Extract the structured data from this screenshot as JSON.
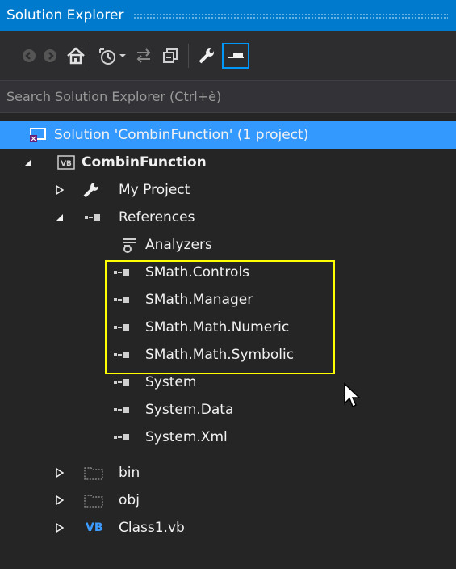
{
  "panel": {
    "title": "Solution Explorer"
  },
  "toolbar": {
    "buttons": [
      "back-icon",
      "forward-icon",
      "home-icon",
      "pending-changes-icon",
      "dropdown-icon",
      "sync-icon",
      "collapse-all-icon",
      "properties-icon",
      "preview-icon"
    ]
  },
  "search": {
    "placeholder": "Search Solution Explorer (Ctrl+è)"
  },
  "tree": {
    "solution": "Solution 'CombinFunction' (1 project)",
    "project": "CombinFunction",
    "my_project": "My Project",
    "references": "References",
    "analyzers": "Analyzers",
    "ref_items": [
      "SMath.Controls",
      "SMath.Manager",
      "SMath.Math.Numeric",
      "SMath.Math.Symbolic",
      "System",
      "System.Data",
      "System.Xml"
    ],
    "bin": "bin",
    "obj": "obj",
    "class_file": "Class1.vb",
    "vb_badge": "VB"
  },
  "colors": {
    "selection": "#3399ff",
    "highlight_box": "#ffff00",
    "title_bar": "#007acc"
  }
}
